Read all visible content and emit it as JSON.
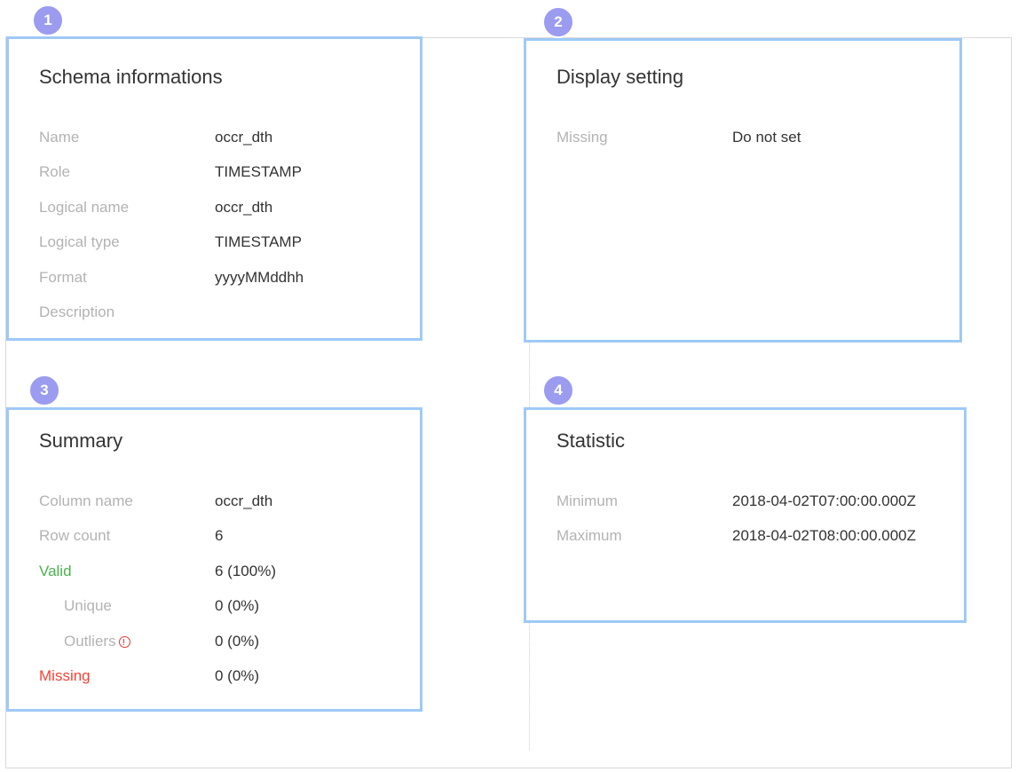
{
  "badges": [
    "1",
    "2",
    "3",
    "4"
  ],
  "schema": {
    "title": "Schema informations",
    "rows": [
      {
        "label": "Name",
        "value": "occr_dth"
      },
      {
        "label": "Role",
        "value": "TIMESTAMP"
      },
      {
        "label": "Logical name",
        "value": "occr_dth"
      },
      {
        "label": "Logical type",
        "value": "TIMESTAMP"
      },
      {
        "label": "Format",
        "value": "yyyyMMddhh"
      },
      {
        "label": "Description",
        "value": ""
      }
    ]
  },
  "display": {
    "title": "Display setting",
    "rows": [
      {
        "label": "Missing",
        "value": "Do not set"
      }
    ]
  },
  "summary": {
    "title": "Summary",
    "rows": [
      {
        "label": "Column name",
        "value": "occr_dth"
      },
      {
        "label": "Row count",
        "value": "6"
      },
      {
        "label": "Valid",
        "value": "6 (100%)"
      },
      {
        "label": "Unique",
        "value": "0 (0%)"
      },
      {
        "label": "Outliers",
        "value": "0 (0%)"
      },
      {
        "label": "Missing",
        "value": "0 (0%)"
      }
    ]
  },
  "statistic": {
    "title": "Statistic",
    "rows": [
      {
        "label": "Minimum",
        "value": "2018-04-02T07:00:00.000Z"
      },
      {
        "label": "Maximum",
        "value": "2018-04-02T08:00:00.000Z"
      }
    ]
  },
  "colors": {
    "panel_border": "#9ec9f7",
    "badge": "#9b9bf0",
    "valid": "#4caf50",
    "missing": "#f44336"
  }
}
